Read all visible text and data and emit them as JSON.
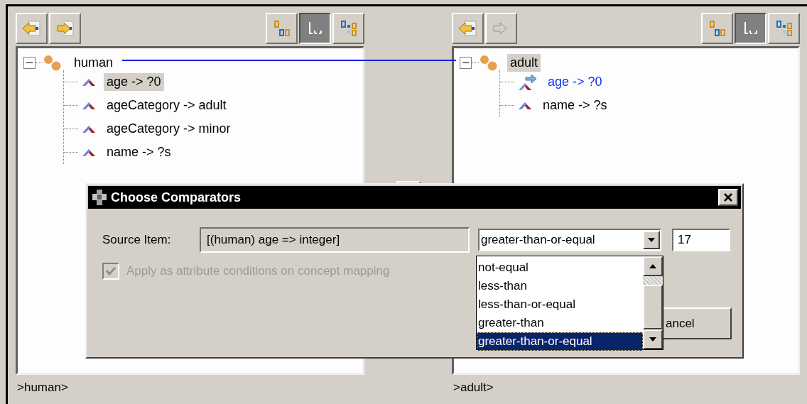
{
  "left_panel": {
    "nav_buttons": [
      {
        "kind": "back",
        "disabled": false
      },
      {
        "kind": "forward",
        "disabled": false
      }
    ],
    "view_buttons": [
      {
        "kind": "nodes",
        "selected": false
      },
      {
        "kind": "tree",
        "selected": true
      },
      {
        "kind": "links",
        "selected": false
      }
    ],
    "tree": {
      "label": "human",
      "expanded": true,
      "selected": false,
      "children": [
        {
          "label": "age -> ?0",
          "selected": true,
          "mapped": false
        },
        {
          "label": "ageCategory -> adult",
          "selected": false,
          "mapped": false
        },
        {
          "label": "ageCategory -> minor",
          "selected": false,
          "mapped": false
        },
        {
          "label": "name -> ?s",
          "selected": false,
          "mapped": false
        }
      ]
    },
    "status": ">human>"
  },
  "right_panel": {
    "nav_buttons": [
      {
        "kind": "back",
        "disabled": false
      },
      {
        "kind": "forward",
        "disabled": true
      }
    ],
    "view_buttons": [
      {
        "kind": "nodes",
        "selected": false
      },
      {
        "kind": "tree",
        "selected": true
      },
      {
        "kind": "links",
        "selected": false
      }
    ],
    "tree": {
      "label": "adult",
      "expanded": true,
      "selected": true,
      "children": [
        {
          "label": "age -> ?0",
          "selected": false,
          "mapped": true
        },
        {
          "label": "name -> ?s",
          "selected": false,
          "mapped": false
        }
      ]
    },
    "status": ">adult>"
  },
  "dialog": {
    "title": "Choose Comparators",
    "source_label": "Source Item:",
    "source_value": "[(human) age => integer]",
    "comparator": {
      "value": "greater-than-or-equal",
      "options": [
        {
          "label": "not-equal",
          "selected": false
        },
        {
          "label": "less-than",
          "selected": false
        },
        {
          "label": "less-than-or-equal",
          "selected": false
        },
        {
          "label": "greater-than",
          "selected": false
        },
        {
          "label": "greater-than-or-equal",
          "selected": true
        }
      ]
    },
    "threshold": "17",
    "apply_checkbox": {
      "label": "Apply as attribute conditions on concept mapping",
      "checked": true,
      "disabled": true
    },
    "cancel_button": "ancel"
  }
}
